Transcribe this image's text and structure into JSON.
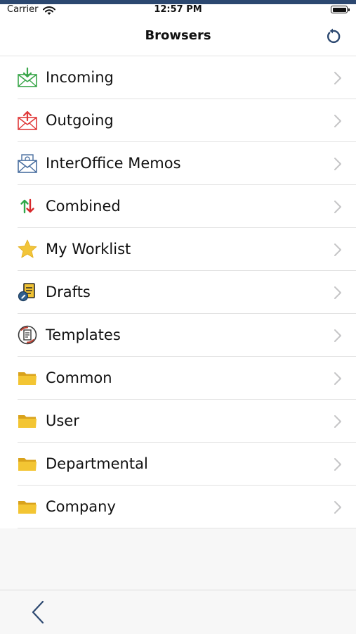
{
  "status_bar": {
    "carrier": "Carrier",
    "time": "12:57 PM"
  },
  "nav": {
    "title": "Browsers",
    "refresh_icon": "refresh-icon"
  },
  "items": [
    {
      "label": "Incoming",
      "icon": "incoming-mail-icon"
    },
    {
      "label": "Outgoing",
      "icon": "outgoing-mail-icon"
    },
    {
      "label": "InterOffice Memos",
      "icon": "memo-mail-icon"
    },
    {
      "label": "Combined",
      "icon": "up-down-arrows-icon"
    },
    {
      "label": "My Worklist",
      "icon": "star-icon"
    },
    {
      "label": "Drafts",
      "icon": "draft-document-icon"
    },
    {
      "label": "Templates",
      "icon": "template-icon"
    },
    {
      "label": "Common",
      "icon": "folder-icon"
    },
    {
      "label": "User",
      "icon": "folder-icon"
    },
    {
      "label": "Departmental",
      "icon": "folder-icon"
    },
    {
      "label": "Company",
      "icon": "folder-icon"
    }
  ],
  "bottom": {
    "back_icon": "back-chevron-icon"
  },
  "colors": {
    "accent": "#2c4870",
    "incoming": "#3aa64a",
    "outgoing": "#e03a3a",
    "folder": "#f0c233",
    "star": "#f2c53a"
  }
}
